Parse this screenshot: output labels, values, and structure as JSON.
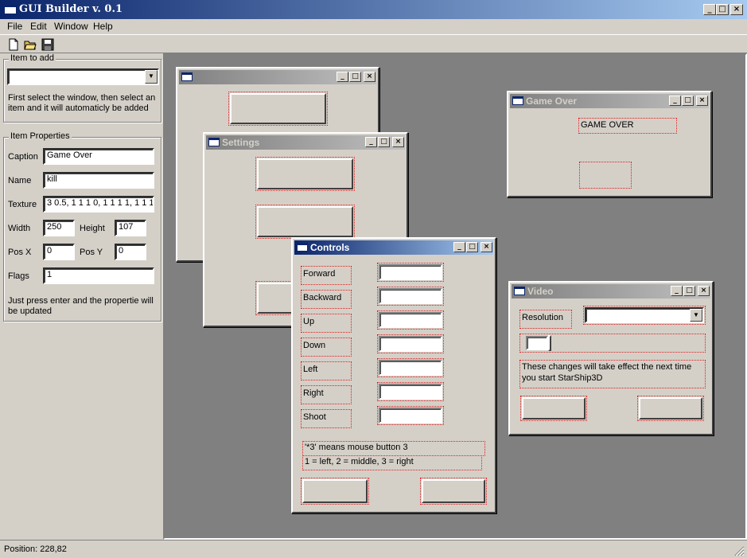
{
  "app": {
    "title": "GUI Builder v. 0.1"
  },
  "menu": [
    "File",
    "Edit",
    "Window",
    "Help"
  ],
  "toolbar": {
    "icons": [
      "new-file-icon",
      "open-folder-icon",
      "save-disk-icon"
    ]
  },
  "item_to_add": {
    "group_label": "Item to add",
    "combo_value": "",
    "hint": "First select the window, then select an item and it will automaticly be added"
  },
  "props": {
    "group_label": "Item Properties",
    "caption_label": "Caption",
    "caption_value": "Game Over",
    "name_label": "Name",
    "name_value": "kill",
    "texture_label": "Texture",
    "texture_value": "3 0.5, 1 1 1 0, 1 1 1 1, 1 1 1",
    "width_label": "Width",
    "width_value": "250",
    "height_label": "Height",
    "height_value": "107",
    "posx_label": "Pos X",
    "posx_value": "0",
    "posy_label": "Pos Y",
    "posy_value": "0",
    "flags_label": "Flags",
    "flags_value": "1",
    "hint": "Just press enter and the propertie will be updated"
  },
  "windows": {
    "untitled": {
      "title": ""
    },
    "settings": {
      "title": "Settings"
    },
    "controls": {
      "title": "Controls",
      "labels": [
        "Forward",
        "Backward",
        "Up",
        "Down",
        "Left",
        "Right",
        "Shoot"
      ],
      "note1": "'*3' means mouse button 3",
      "note2": "1 = left, 2 = middle, 3 = right"
    },
    "game_over": {
      "title": "Game Over",
      "label": "GAME OVER"
    },
    "video": {
      "title": "Video",
      "resolution_label": "Resolution",
      "note": "These changes will take effect the next time you start StarShip3D"
    }
  },
  "status": {
    "text": "Position: 228,82"
  }
}
